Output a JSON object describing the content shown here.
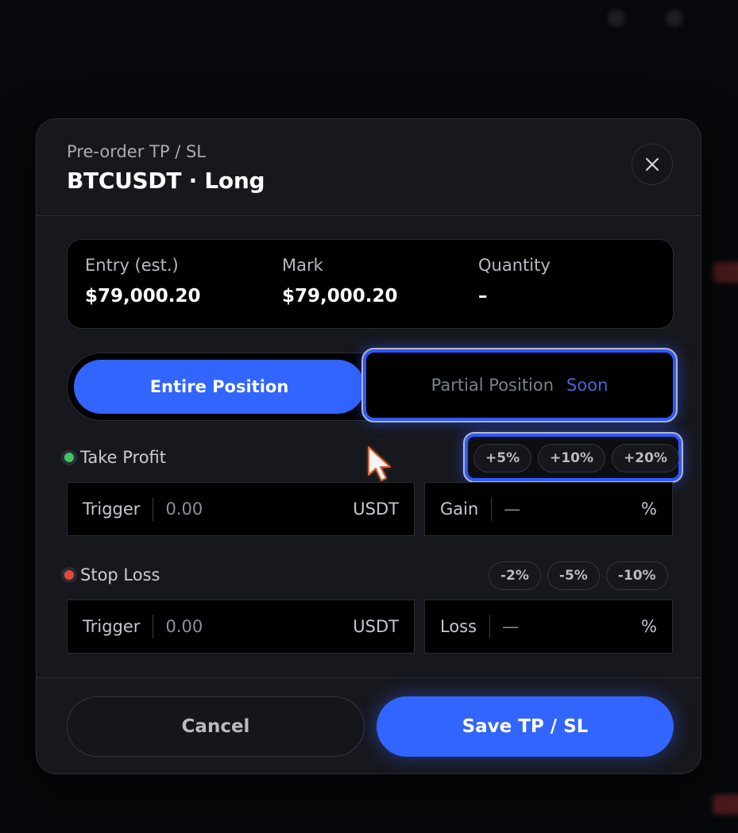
{
  "header": {
    "subtitle": "Pre-order TP / SL",
    "title": "BTCUSDT · Long"
  },
  "info": {
    "entry_label": "Entry (est.)",
    "entry_value": "$79,000.20",
    "mark_label": "Mark",
    "mark_value": "$79,000.20",
    "quantity_label": "Quantity",
    "quantity_value": "–"
  },
  "position_toggle": {
    "entire_label": "Entire Position",
    "partial_label": "Partial Position",
    "partial_badge": "Soon"
  },
  "take_profit": {
    "label": "Take Profit",
    "chips": [
      "+5%",
      "+10%",
      "+20%"
    ],
    "trigger_label": "Trigger",
    "trigger_placeholder": "0.00",
    "trigger_unit": "USDT",
    "gain_label": "Gain",
    "gain_value": "—",
    "gain_unit": "%"
  },
  "stop_loss": {
    "label": "Stop Loss",
    "chips": [
      "-2%",
      "-5%",
      "-10%"
    ],
    "trigger_label": "Trigger",
    "trigger_placeholder": "0.00",
    "trigger_unit": "USDT",
    "loss_label": "Loss",
    "loss_value": "—",
    "loss_unit": "%"
  },
  "footer": {
    "cancel_label": "Cancel",
    "save_label": "Save TP / SL"
  },
  "colors": {
    "accent": "#3264fe",
    "take_profit_dot": "#3ec463",
    "stop_loss_dot": "#e5483f"
  },
  "icons": {
    "close": "close-icon",
    "cursor": "mouse-pointer-icon"
  }
}
